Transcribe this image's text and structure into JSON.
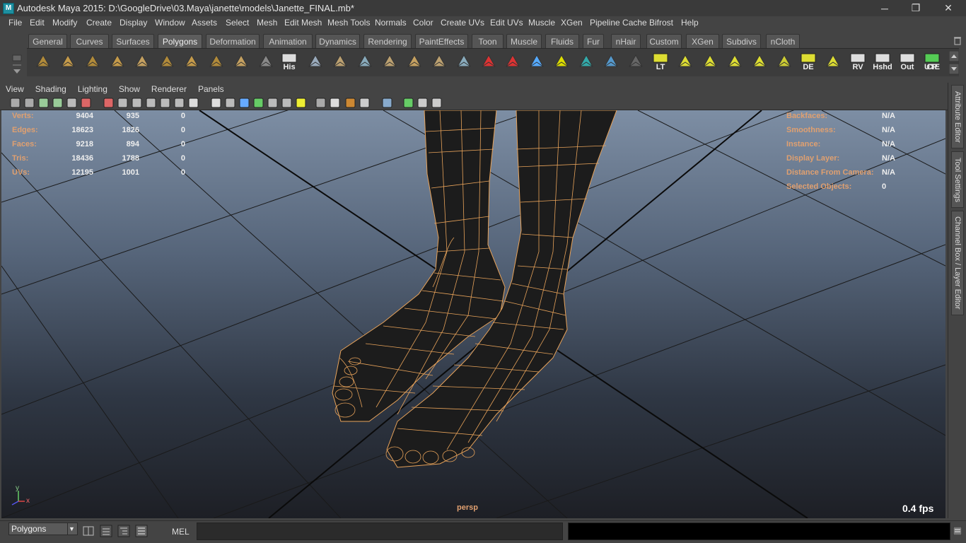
{
  "window": {
    "title": "Autodesk Maya 2015: D:\\GoogleDrive\\03.Maya\\janette\\models\\Janette_FINAL.mb*",
    "minimize": "─",
    "restore": "❐",
    "close": "✕"
  },
  "menubar": [
    "File",
    "Edit",
    "Modify",
    "Create",
    "Display",
    "Window",
    "Assets",
    "Select",
    "Mesh",
    "Edit Mesh",
    "Mesh Tools",
    "Normals",
    "Color",
    "Create UVs",
    "Edit UVs",
    "Muscle",
    "XGen",
    "Pipeline Cache",
    "Bifrost",
    "Help"
  ],
  "shelf_tabs": [
    "General",
    "Curves",
    "Surfaces",
    "Polygons",
    "Deformation",
    "Animation",
    "Dynamics",
    "Rendering",
    "PaintEffects",
    "Toon",
    "Muscle",
    "Fluids",
    "Fur",
    "nHair",
    "Custom",
    "XGen",
    "Subdivs",
    "nCloth"
  ],
  "shelf_active": "Polygons",
  "shelf_icons": [
    {
      "name": "poly-sphere-icon",
      "label": ""
    },
    {
      "name": "poly-cube-icon",
      "label": ""
    },
    {
      "name": "poly-cylinder-icon",
      "label": ""
    },
    {
      "name": "poly-cone-icon",
      "label": ""
    },
    {
      "name": "poly-plane-icon",
      "label": ""
    },
    {
      "name": "poly-torus-icon",
      "label": ""
    },
    {
      "name": "poly-pyramid-icon",
      "label": ""
    },
    {
      "name": "poly-pipe-icon",
      "label": ""
    },
    {
      "name": "create-polygon-icon",
      "label": ""
    },
    {
      "name": "smooth-icon",
      "label": ""
    },
    {
      "name": "history-icon",
      "label": "His"
    },
    {
      "name": "extrude-icon",
      "label": ""
    },
    {
      "name": "bevel-icon",
      "label": ""
    },
    {
      "name": "bridge-icon",
      "label": ""
    },
    {
      "name": "append-icon",
      "label": ""
    },
    {
      "name": "split-icon",
      "label": ""
    },
    {
      "name": "insert-edge-loop-icon",
      "label": ""
    },
    {
      "name": "merge-icon",
      "label": ""
    },
    {
      "name": "offset-edge-icon",
      "label": ""
    },
    {
      "name": "sculpt-icon",
      "label": ""
    },
    {
      "name": "paint-icon",
      "label": ""
    },
    {
      "name": "grid-icon",
      "label": ""
    },
    {
      "name": "manipulator-icon",
      "label": ""
    },
    {
      "name": "soft-mod-icon",
      "label": ""
    },
    {
      "name": "transfer-icon",
      "label": ""
    },
    {
      "name": "lt-icon",
      "label": "LT"
    },
    {
      "name": "uv-planar-icon",
      "label": ""
    },
    {
      "name": "uv-cylindrical-icon",
      "label": ""
    },
    {
      "name": "uv-spherical-icon",
      "label": ""
    },
    {
      "name": "uv-auto-icon",
      "label": ""
    },
    {
      "name": "uv-editor-icon",
      "label": ""
    },
    {
      "name": "de-icon",
      "label": "DE"
    },
    {
      "name": "uv-layout-icon",
      "label": ""
    },
    {
      "name": "rv-icon",
      "label": "RV"
    },
    {
      "name": "hshd-icon",
      "label": "Hshd"
    },
    {
      "name": "out-icon",
      "label": "Out"
    },
    {
      "name": "ute-icon",
      "label": "UTE"
    },
    {
      "name": "cp-icon",
      "label": "CP"
    }
  ],
  "panel_menu": [
    "View",
    "Shading",
    "Lighting",
    "Show",
    "Renderer",
    "Panels"
  ],
  "hud_left": [
    {
      "label": "Verts:",
      "a": "9404",
      "b": "935",
      "c": "0"
    },
    {
      "label": "Edges:",
      "a": "18623",
      "b": "1826",
      "c": "0"
    },
    {
      "label": "Faces:",
      "a": "9218",
      "b": "894",
      "c": "0"
    },
    {
      "label": "Tris:",
      "a": "18436",
      "b": "1788",
      "c": "0"
    },
    {
      "label": "UVs:",
      "a": "12195",
      "b": "1001",
      "c": "0"
    }
  ],
  "hud_right": [
    {
      "label": "Backfaces:",
      "value": "N/A"
    },
    {
      "label": "Smoothness:",
      "value": "N/A"
    },
    {
      "label": "Instance:",
      "value": "N/A"
    },
    {
      "label": "Display Layer:",
      "value": "N/A"
    },
    {
      "label": "Distance From Camera:",
      "value": "N/A"
    },
    {
      "label": "Selected Objects:",
      "value": "0"
    }
  ],
  "camera": "persp",
  "fps": "0.4 fps",
  "axis": {
    "y": "y",
    "x": "x"
  },
  "side_tabs": [
    "Attribute Editor",
    "Tool Settings",
    "Channel Box / Layer Editor"
  ],
  "status": {
    "mode": "Polygons",
    "mel_label": "MEL"
  },
  "colors": {
    "wire": "#e8a35a",
    "hud_label": "#e0a070",
    "mesh": "#1a1a1a"
  }
}
